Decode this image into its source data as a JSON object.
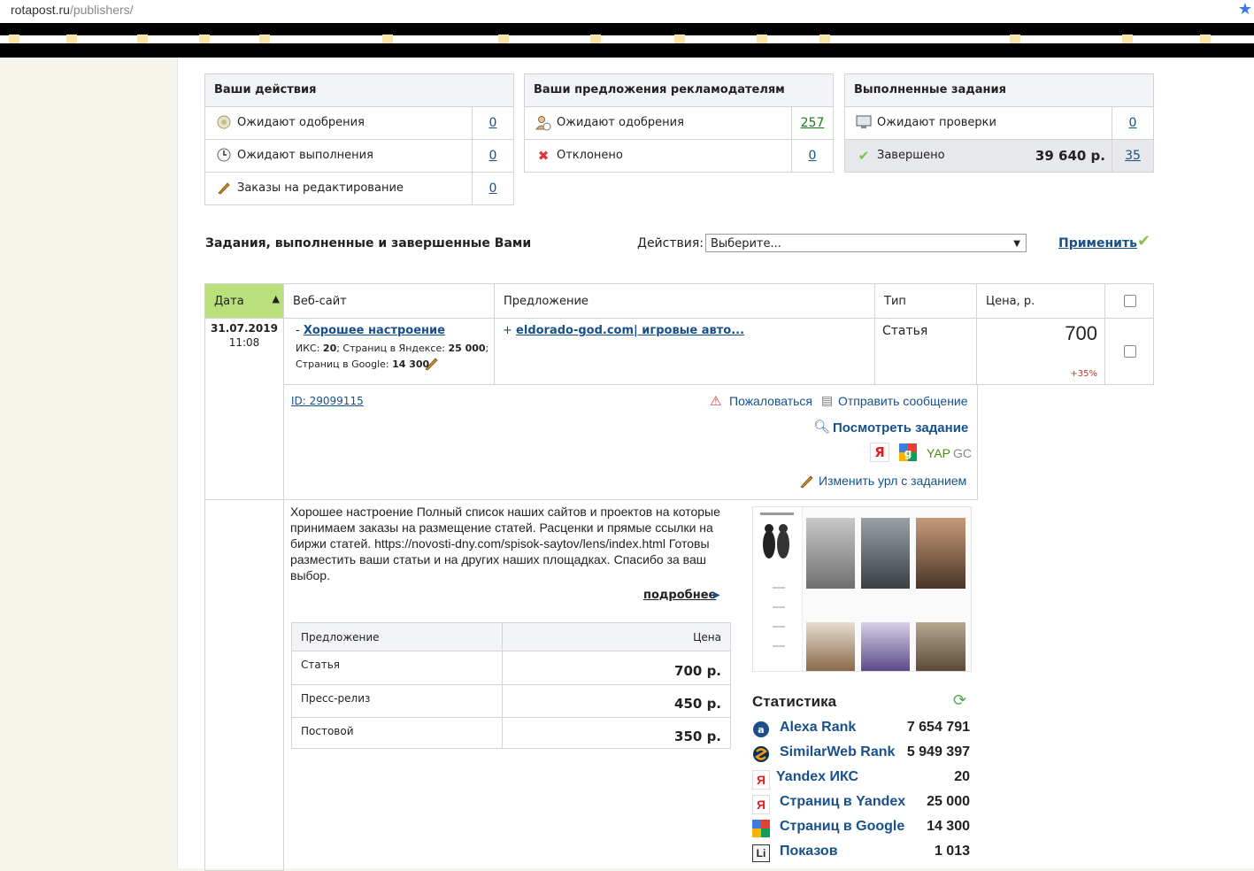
{
  "browser": {
    "url_host": "rotapost.ru",
    "url_path": "/publishers/"
  },
  "panels": {
    "actions": {
      "title": "Ваши действия",
      "rows": [
        {
          "label": "Ожидают одобрения",
          "count": "0"
        },
        {
          "label": "Ожидают выполнения",
          "count": "0"
        },
        {
          "label": "Заказы на редактирование",
          "count": "0"
        }
      ]
    },
    "offers": {
      "title": "Ваши предложения рекламодателям",
      "rows": [
        {
          "label": "Ожидают одобрения",
          "count": "257"
        },
        {
          "label": "Отклонено",
          "count": "0"
        }
      ]
    },
    "completed": {
      "title": "Выполненные задания",
      "rows": [
        {
          "label": "Ожидают проверки",
          "count": "0"
        },
        {
          "label": "Завершено",
          "amount": "39 640 р.",
          "count": "35"
        }
      ]
    }
  },
  "section": {
    "title": "Задания, выполненные и завершенные Вами",
    "actions_label": "Действия:",
    "select_value": "Выберите...",
    "apply_label": "Применить"
  },
  "table": {
    "headers": {
      "date": "Дата",
      "site": "Веб-сайт",
      "offer": "Предложение",
      "type": "Тип",
      "price": "Цена, р."
    },
    "row": {
      "date": "31.07.2019",
      "time": "11:08",
      "site_prefix": "-",
      "site_name": "Хорошее настроение",
      "site_stats_line1_a": "ИКС: ",
      "site_stats_line1_b": "20",
      "site_stats_line1_c": "; Страниц в Яндексе: ",
      "site_stats_line1_d": "25 000",
      "site_stats_line1_e": ";",
      "site_stats_line2_a": "Страниц в Google: ",
      "site_stats_line2_b": "14 300",
      "offer_prefix": "+",
      "offer_link": "eldorado-god.com| игровые авто...",
      "type": "Статья",
      "price": "700",
      "price_delta": "+35%"
    },
    "details": {
      "id_link": "ID: 29099115",
      "complain": "Пожаловаться",
      "send_message": "Отправить сообщение",
      "view_task": "Посмотреть задание",
      "yap": "YAP",
      "gc": "GC",
      "change_url": "Изменить урл с заданием"
    }
  },
  "site_info": {
    "description": "Хорошее настроение Полный список наших сайтов и проектов на которые принимаем заказы на размещение статей. Расценки и прямые ссылки на биржи статей. https://novosti-dny.com/spisok-saytov/lens/index.html Готовы разместить ваши статьи и на других наших площадках. Спасибо за ваш выбор.",
    "more_link": "подробнее",
    "price_table": {
      "col_offer": "Предложение",
      "col_price": "Цена",
      "rows": [
        {
          "name": "Статья",
          "price": "700 р."
        },
        {
          "name": "Пресс-релиз",
          "price": "450 р."
        },
        {
          "name": "Постовой",
          "price": "350 р."
        }
      ]
    }
  },
  "stats": {
    "title": "Статистика",
    "rows": [
      {
        "icon": "alexa-icon",
        "label": "Alexa Rank",
        "value": "7 654 791"
      },
      {
        "icon": "similarweb-icon",
        "label": "SimilarWeb Rank",
        "value": "5 949 397"
      },
      {
        "icon": "yandex-icon",
        "label": "Yandex ИКС",
        "value": "20"
      },
      {
        "icon": "yandex-icon",
        "label": "Страниц в Yandex",
        "value": "25 000"
      },
      {
        "icon": "google-icon",
        "label": "Страниц в Google",
        "value": "14 300"
      },
      {
        "icon": "liveinternet-icon",
        "label": "Показов",
        "value": "1 013"
      }
    ]
  }
}
